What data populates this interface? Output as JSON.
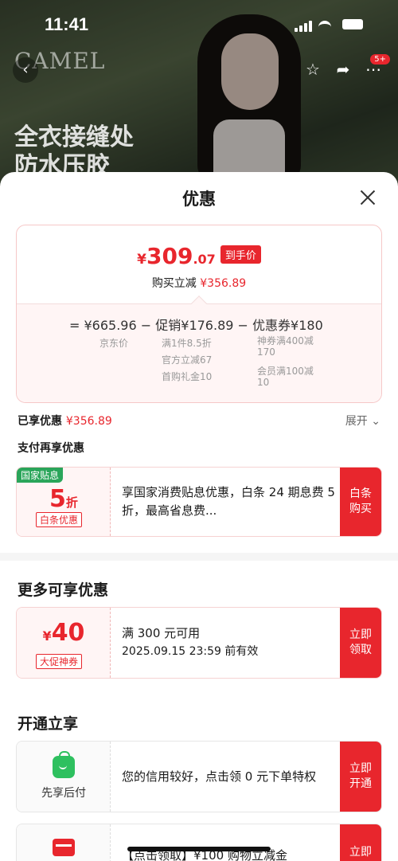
{
  "status": {
    "time": "11:41"
  },
  "background": {
    "brand": "CAMEL",
    "promo_line1": "全衣接缝处",
    "promo_line2": "防水压胶",
    "badge": "5+"
  },
  "sheet": {
    "title": "优惠",
    "price": {
      "currency": "¥",
      "integer": "309",
      "decimal": ".07",
      "tag": "到手价",
      "instant_label": "购买立减",
      "instant_value": "¥356.89"
    },
    "formula": {
      "eq": "=",
      "base": "¥665.96",
      "minus1": "−",
      "promo": "促销¥176.89",
      "minus2": "−",
      "coupon": "优惠券¥180",
      "base_label": "京东价",
      "promo_details": [
        "满1件8.5折",
        "官方立减67",
        "首购礼金10"
      ],
      "coupon_details": [
        "神券满400减170",
        "会员满100减10"
      ]
    },
    "applied_label": "已享优惠",
    "applied_value": "¥356.89",
    "expand": "展开",
    "pay_title": "支付再享优惠",
    "gov_coupon": {
      "flag": "国家贴息",
      "discount_num": "5",
      "discount_unit": "折",
      "pill": "白条优惠",
      "text": "享国家消费贴息优惠，白条 24 期息费 5 折，最高省息费...",
      "button": "白条购买"
    },
    "more_title": "更多可享优惠",
    "voucher": {
      "currency": "¥",
      "amount": "40",
      "pill": "大促神券",
      "line1": "满 300 元可用",
      "line2": "2025.09.15 23:59 前有效",
      "button": "立即领取"
    },
    "open_title": "开通立享",
    "credit": {
      "icon_caption": "先享后付",
      "text": "您的信用较好，点击领 0 元下单特权",
      "button": "立即开通"
    },
    "partial": {
      "text": "【点击领取】¥100 购物立减金",
      "button": "立即"
    }
  }
}
